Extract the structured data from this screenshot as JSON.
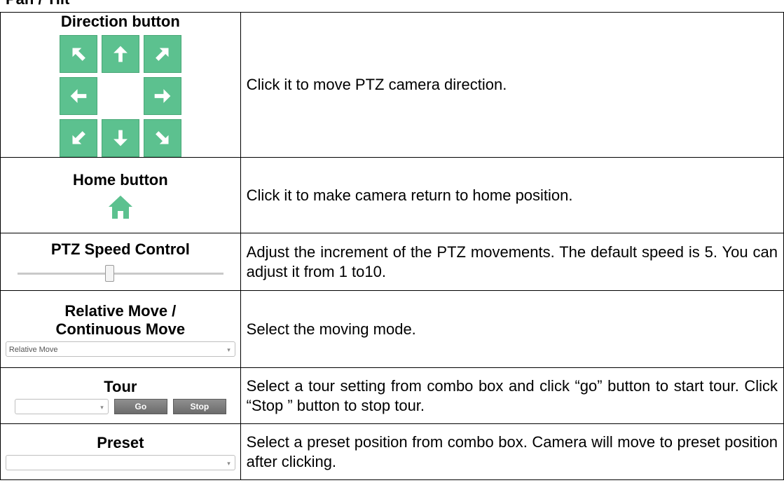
{
  "section_title": "Pan / Tilt",
  "rows": [
    {
      "title": "Direction button",
      "description": "Click it to move PTZ camera direction."
    },
    {
      "title": "Home button",
      "description": "Click it to make camera return to home position."
    },
    {
      "title": "PTZ Speed Control",
      "description": "Adjust the increment of the PTZ movements. The default speed is 5. You can adjust it from 1 to10."
    },
    {
      "title_line1": "Relative Move /",
      "title_line2": "Continuous Move",
      "description": "Select the moving mode.",
      "combo_value": "Relative Move"
    },
    {
      "title": "Tour",
      "description": "Select a tour setting from combo box and click “go” button to start tour. Click “Stop ” button to stop tour.",
      "go_label": "Go",
      "stop_label": "Stop",
      "combo_value": ""
    },
    {
      "title": "Preset",
      "description": "Select a preset position from combo box. Camera will move to preset position after clicking.",
      "combo_value": ""
    }
  ],
  "direction_pad": {
    "icons": [
      "arrow-up-left-icon",
      "arrow-up-icon",
      "arrow-up-right-icon",
      "arrow-left-icon",
      "arrow-right-icon",
      "arrow-down-left-icon",
      "arrow-down-icon",
      "arrow-down-right-icon"
    ],
    "color": "#5cc18f"
  },
  "home_icon": {
    "name": "home-icon",
    "color": "#5cc18f"
  },
  "speed_control": {
    "min": 1,
    "max": 10,
    "value": 5
  },
  "combo_arrow": "▾"
}
